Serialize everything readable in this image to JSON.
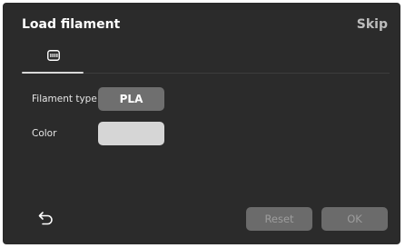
{
  "header": {
    "title": "Load filament",
    "skip_label": "Skip"
  },
  "tabs": [
    {
      "icon": "filament-spool-icon",
      "active": true
    }
  ],
  "form": {
    "filament_type_label": "Filament type",
    "filament_type_value": "PLA",
    "color_label": "Color",
    "color_value": "#d6d6d6"
  },
  "footer": {
    "back_icon": "back-arrow-icon",
    "reset_label": "Reset",
    "ok_label": "OK"
  }
}
